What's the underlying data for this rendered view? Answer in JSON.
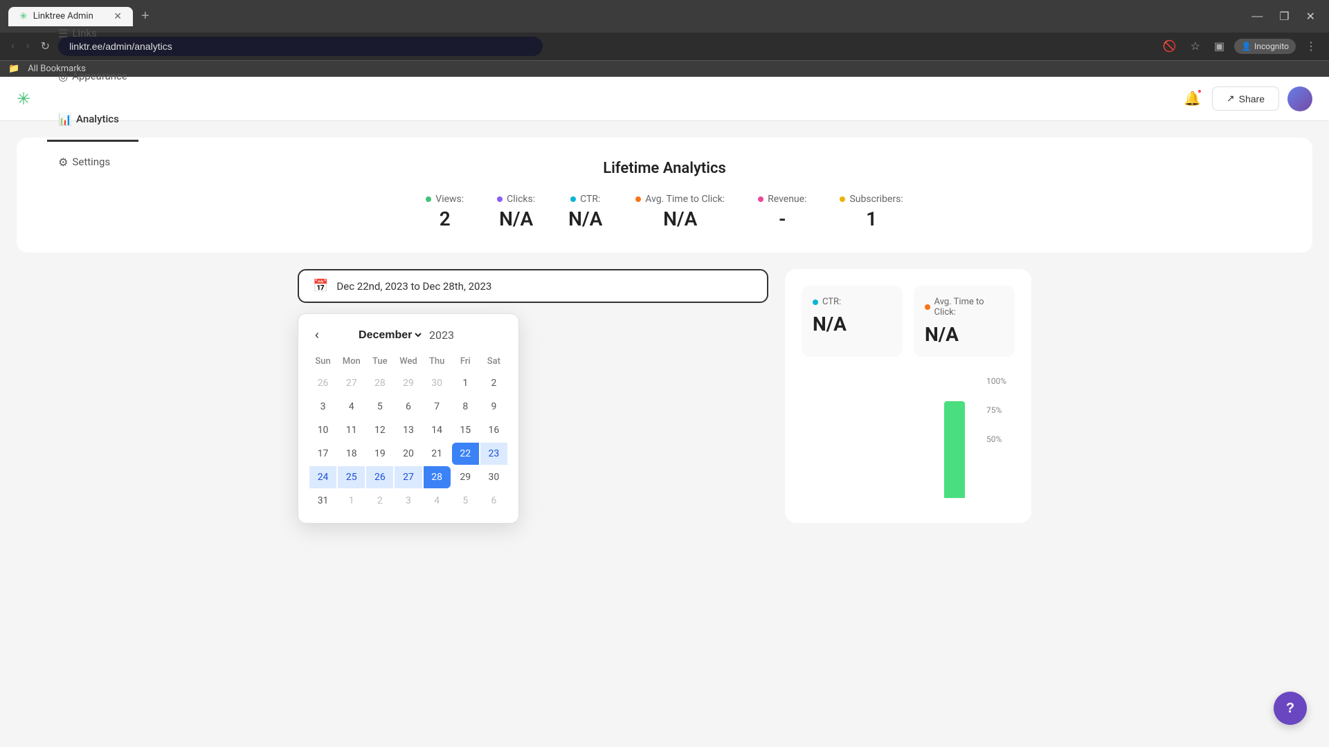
{
  "browser": {
    "tab_title": "Linktree Admin",
    "favicon": "✳",
    "url": "linktr.ee/admin/analytics",
    "new_tab_label": "+",
    "nav": {
      "back": "‹",
      "forward": "›",
      "refresh": "↻"
    },
    "window_controls": {
      "minimize": "—",
      "maximize": "❐",
      "close": "✕"
    },
    "incognito_label": "Incognito",
    "bookmarks_label": "All Bookmarks"
  },
  "header": {
    "logo": "✳",
    "nav_items": [
      {
        "id": "links",
        "label": "Links",
        "icon": "☰",
        "active": false
      },
      {
        "id": "appearance",
        "label": "Appearance",
        "icon": "◎",
        "active": false
      },
      {
        "id": "analytics",
        "label": "Analytics",
        "icon": "📊",
        "active": true
      },
      {
        "id": "settings",
        "label": "Settings",
        "icon": "⚙",
        "active": false
      }
    ],
    "share_label": "Share",
    "share_icon": "↗"
  },
  "lifetime_analytics": {
    "title": "Lifetime Analytics",
    "metrics": [
      {
        "id": "views",
        "label": "Views:",
        "value": "2",
        "dot_color": "#43c278"
      },
      {
        "id": "clicks",
        "label": "Clicks:",
        "value": "N/A",
        "dot_color": "#8b5cf6"
      },
      {
        "id": "ctr",
        "label": "CTR:",
        "value": "N/A",
        "dot_color": "#06b6d4"
      },
      {
        "id": "avg_time",
        "label": "Avg. Time to Click:",
        "value": "N/A",
        "dot_color": "#f97316"
      },
      {
        "id": "revenue",
        "label": "Revenue:",
        "value": "-",
        "dot_color": "#ec4899"
      },
      {
        "id": "subscribers",
        "label": "Subscribers:",
        "value": "1",
        "dot_color": "#eab308"
      }
    ]
  },
  "date_picker": {
    "date_range_text": "Dec 22nd, 2023 to Dec 28th, 2023",
    "calendar": {
      "month_label": "December",
      "year_label": "2023",
      "weekdays": [
        "Sun",
        "Mon",
        "Tue",
        "Wed",
        "Thu",
        "Fri",
        "Sat"
      ],
      "rows": [
        [
          "26",
          "27",
          "28",
          "29",
          "30",
          "1",
          "2"
        ],
        [
          "3",
          "4",
          "5",
          "6",
          "7",
          "8",
          "9"
        ],
        [
          "10",
          "11",
          "12",
          "13",
          "14",
          "15",
          "16"
        ],
        [
          "17",
          "18",
          "19",
          "20",
          "21",
          "22",
          "23"
        ],
        [
          "24",
          "25",
          "26",
          "27",
          "28",
          "29",
          "30"
        ],
        [
          "31",
          "1",
          "2",
          "3",
          "4",
          "5",
          "6"
        ]
      ],
      "other_month_days_row0": [
        true,
        true,
        true,
        true,
        true,
        false,
        false
      ],
      "selected_start_col": 5,
      "selected_start_row": 3,
      "selected_end_col": 4,
      "selected_end_row": 4
    }
  },
  "stats_panel": {
    "ctr_label": "CTR:",
    "ctr_dot_color": "#06b6d4",
    "ctr_value": "N/A",
    "avg_time_label": "Avg. Time to Click:",
    "avg_time_dot_color": "#f97316",
    "avg_time_value": "N/A",
    "chart_labels": [
      "100%",
      "75%",
      "50%"
    ]
  },
  "help_button": {
    "label": "?"
  }
}
